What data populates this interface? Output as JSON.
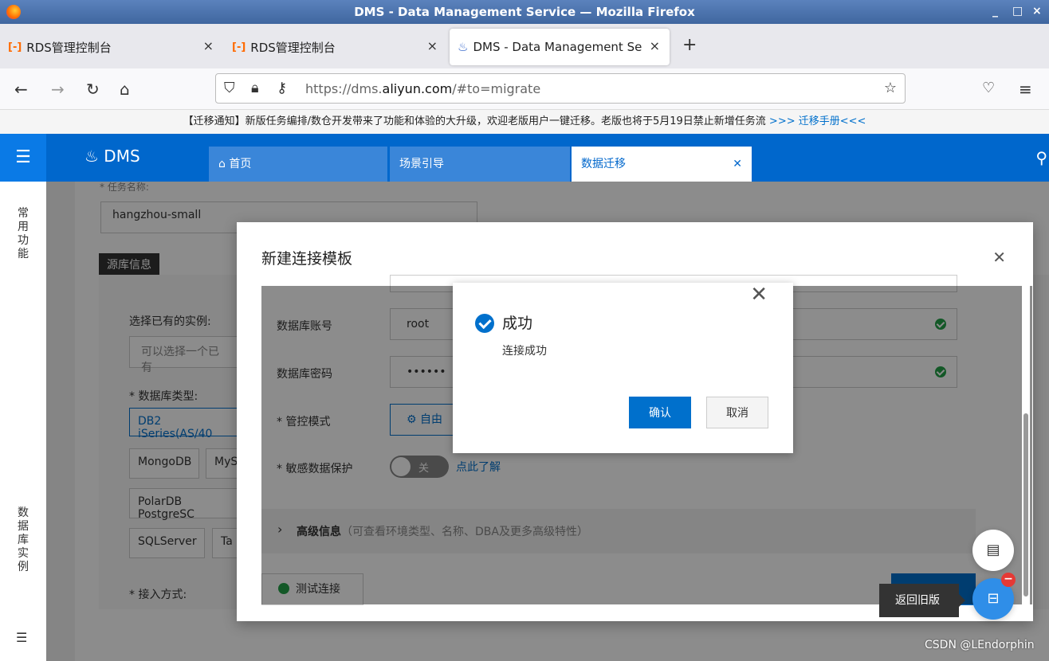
{
  "browser": {
    "window_title": "DMS - Data Management Service — Mozilla Firefox",
    "controls": [
      "_",
      "□",
      "×"
    ],
    "tabs": [
      {
        "label": "RDS管理控制台",
        "icon": "aliyun-icon"
      },
      {
        "label": "RDS管理控制台",
        "icon": "aliyun-icon"
      },
      {
        "label": "DMS - Data Management Se",
        "icon": "dms-icon"
      }
    ],
    "new_tab": "+",
    "url_prefix": "https://dms.",
    "url_host": "aliyun.com",
    "url_suffix": "/#to=migrate"
  },
  "notice": {
    "text": "【迁移通知】新版任务编排/数仓开发带来了功能和体验的大升级，欢迎老版用户一键迁移。老版也将于5月19日禁止新增任务流",
    "link": ">>> 迁移手册<<<"
  },
  "header": {
    "logo": "DMS",
    "tabs": [
      {
        "label": "首页"
      },
      {
        "label": "场景引导"
      },
      {
        "label": "数据迁移"
      }
    ]
  },
  "sidebar": {
    "common": "常用功能",
    "instances": "数据库实例"
  },
  "background_form": {
    "task_name_label": "* 任务名称:",
    "task_name": "hangzhou-small",
    "source_badge": "源库信息",
    "select_instance_label": "选择已有的实例:",
    "select_instance_placeholder": "可以选择一个已有",
    "db_type_label": "* 数据库类型:",
    "db_type_selected": "DB2 iSeries(AS/40",
    "types": [
      "MongoDB",
      "MyS",
      "PolarDB PostgreSC",
      "SQLServer",
      "Ta"
    ],
    "access_label": "* 接入方式:"
  },
  "modal": {
    "title": "新建连接模板",
    "account_label": "数据库账号",
    "account_value": "root",
    "password_label": "数据库密码",
    "password_value": "••••••",
    "control_label": "* 管控模式",
    "control_value": "自由",
    "sensitive_label": "* 敏感数据保护",
    "toggle_label": "关",
    "learn_more": "点此了解",
    "advanced_title": "高级信息",
    "advanced_hint": "（可查看环境类型、名称、DBA及更多高级特性）",
    "test_button": "测试连接"
  },
  "popup": {
    "title": "成功",
    "message": "连接成功",
    "confirm": "确认",
    "cancel": "取消"
  },
  "floating": {
    "tooltip": "返回旧版"
  },
  "watermark": "CSDN @LEndorphin",
  "colors": {
    "brand": "#0067cc",
    "success": "#24a148",
    "primary_button": "#0070cc"
  }
}
